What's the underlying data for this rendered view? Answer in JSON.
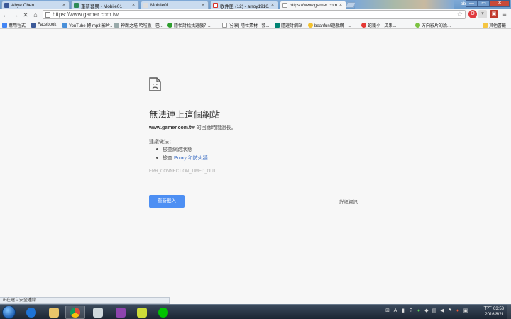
{
  "tabs": [
    {
      "title": "Abye Chen",
      "icon": "facebook-icon",
      "color": "#3b5998"
    },
    {
      "title": "重新套購 - Mobile01",
      "icon": "mobile01-icon",
      "color": "#2e8b57"
    },
    {
      "title": "Mobile01",
      "icon": "mobile01-icon",
      "color": "#cccccc"
    },
    {
      "title": "收件匣 (12) - arroy1916...",
      "icon": "gmail-icon",
      "color": "#d93025"
    },
    {
      "title": "https://www.gamer.com...",
      "icon": "page-icon",
      "color": "#ffffff"
    }
  ],
  "window": {
    "user": "abye",
    "minimize": "—",
    "maximize": "▭",
    "close": "✕"
  },
  "toolbar": {
    "back": "←",
    "forward": "→",
    "stop": "✕",
    "home": "⌂",
    "url": "https://www.gamer.com.tw",
    "star": "☆",
    "menu": "≡"
  },
  "bookmarks": [
    {
      "label": "應用程式",
      "icon": "apps-icon",
      "color": "#4285f4"
    },
    {
      "label": "Facebook",
      "icon": "facebook-icon",
      "color": "#3b5998"
    },
    {
      "label": "YouTube 轉 mp3 影片...",
      "icon": "youtube-mp3-icon",
      "color": "#4a90d9"
    },
    {
      "label": "神魔之塔 哈啦板 - 巴...",
      "icon": "bahamut-icon",
      "color": "#9aa"
    },
    {
      "label": "隱忙討找找遊戲？...",
      "icon": "game-icon",
      "color": "#2e9e2e"
    },
    {
      "label": "[分享] 隱忙素材 - 套...",
      "icon": "page-icon",
      "color": "#ffffff"
    },
    {
      "label": "隱遊討網站",
      "icon": "bing-icon",
      "color": "#008373"
    },
    {
      "label": "beanfun!遊戲網 - ...",
      "icon": "beanfun-icon",
      "color": "#f2c12e"
    },
    {
      "label": "蛇鐵小 - 瓜果...",
      "icon": "red-circle-icon",
      "color": "#e53935"
    },
    {
      "label": "方向影片的論...",
      "icon": "green-circle-icon",
      "color": "#7cc242"
    },
    {
      "label": "其他書籤",
      "icon": "folder-icon",
      "color": "#f4c542"
    }
  ],
  "error": {
    "title": "無法連上這個網站",
    "host": "www.gamer.com.tw",
    "message": " 的回應時間過長。",
    "suggest_title": "建議做法：",
    "suggestions": [
      {
        "text": "檢查網路狀態",
        "is_link": false
      },
      {
        "prefix": "檢查",
        "link": "Proxy 和防火牆",
        "is_link": true
      }
    ],
    "code": "ERR_CONNECTION_TIMED_OUT",
    "reload_label": "重新載入",
    "details_label": "詳細資訊"
  },
  "status": "正在建立安全連線...",
  "taskbar": {
    "apps": [
      {
        "name": "internet-explorer-icon",
        "color": "#1e73d6",
        "open": false
      },
      {
        "name": "file-explorer-icon",
        "color": "#e9c46a",
        "open": false
      },
      {
        "name": "chrome-icon",
        "color": "#dd4b39",
        "open": true
      },
      {
        "name": "cloud-app-icon",
        "color": "#cfd8dc",
        "open": false
      },
      {
        "name": "winrar-icon",
        "color": "#8e44ad",
        "open": false
      },
      {
        "name": "sticky-folder-icon",
        "color": "#cddc39",
        "open": false
      },
      {
        "name": "line-icon",
        "color": "#00c300",
        "open": false
      }
    ],
    "time": "下午 03:53",
    "date": "2016/8/21"
  }
}
